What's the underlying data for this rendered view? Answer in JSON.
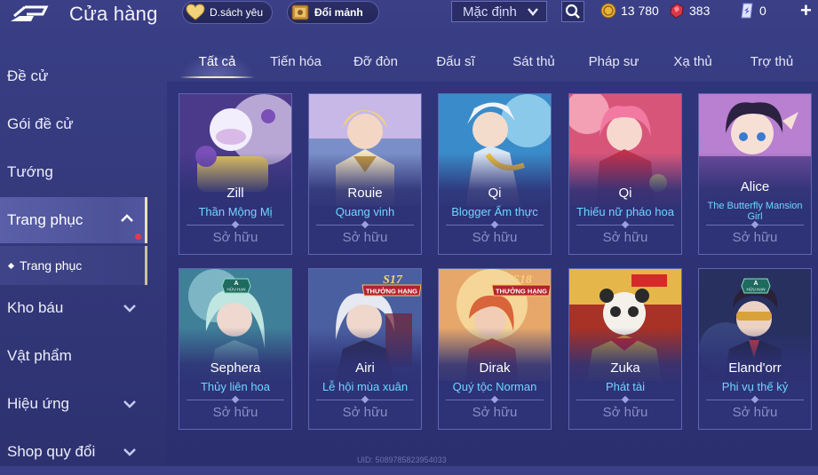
{
  "header": {
    "title": "Cửa hàng",
    "wishlist_label": "D.sách yêu",
    "exchange_label": "Đổi mảnh",
    "sort_label": "Mặc định",
    "gold_amount": "13 780",
    "ruby_amount": "383",
    "voucher_amount": "0"
  },
  "sidebar": {
    "items": [
      {
        "label": "Đề cử"
      },
      {
        "label": "Gói đề cử"
      },
      {
        "label": "Tướng"
      },
      {
        "label": "Trang phục"
      },
      {
        "label": "Kho báu"
      },
      {
        "label": "Vật phẩm"
      },
      {
        "label": "Hiệu ứng"
      },
      {
        "label": "Shop quy đổi"
      }
    ],
    "sub_item": "Trang phục"
  },
  "tabs": [
    "Tất cả",
    "Tiến hóa",
    "Đỡ đòn",
    "Đấu sĩ",
    "Sát thủ",
    "Pháp sư",
    "Xạ thủ",
    "Trợ thủ"
  ],
  "cards": [
    {
      "hero": "Zill",
      "skin": "Thần Mộng Mị",
      "status": "Sở hữu"
    },
    {
      "hero": "Rouie",
      "skin": "Quang vinh",
      "status": "Sở hữu"
    },
    {
      "hero": "Qi",
      "skin": "Blogger Ẩm thực",
      "status": "Sở hữu"
    },
    {
      "hero": "Qi",
      "skin": "Thiếu nữ pháo hoa",
      "status": "Sở hữu"
    },
    {
      "hero": "Alice",
      "skin": "The Butterfly Mansion Girl",
      "status": "Sở hữu"
    },
    {
      "hero": "Sephera",
      "skin": "Thủy liên hoa",
      "status": "Sở hữu",
      "badge": "A",
      "badge_sub": "HỮU HẠN"
    },
    {
      "hero": "Airi",
      "skin": "Lễ hội mùa xuân",
      "status": "Sở hữu",
      "season": "S17",
      "season_sub": "THƯỞNG HẠNG"
    },
    {
      "hero": "Dirak",
      "skin": "Quý tộc Norman",
      "status": "Sở hữu",
      "season": "S18",
      "season_sub": "THƯỞNG HẠNG"
    },
    {
      "hero": "Zuka",
      "skin": "Phát tài",
      "status": "Sở hữu"
    },
    {
      "hero": "Eland'orr",
      "skin": "Phi vụ thế kỷ",
      "status": "Sở hữu",
      "badge": "A",
      "badge_sub": "HỮU HẠN"
    }
  ],
  "footer": {
    "uid": "UID: 5089785823954033"
  },
  "colors": {
    "background": "#363b80",
    "skin_name": "#6fd6ff",
    "owned": "#8a8fc8",
    "active_border": "#e8e2b8"
  },
  "icons": [
    "back-arrow-icon",
    "heart-icon",
    "chest-icon",
    "chevron-down-icon",
    "search-icon",
    "gold-coin-icon",
    "ruby-icon",
    "voucher-icon",
    "plus-icon"
  ]
}
